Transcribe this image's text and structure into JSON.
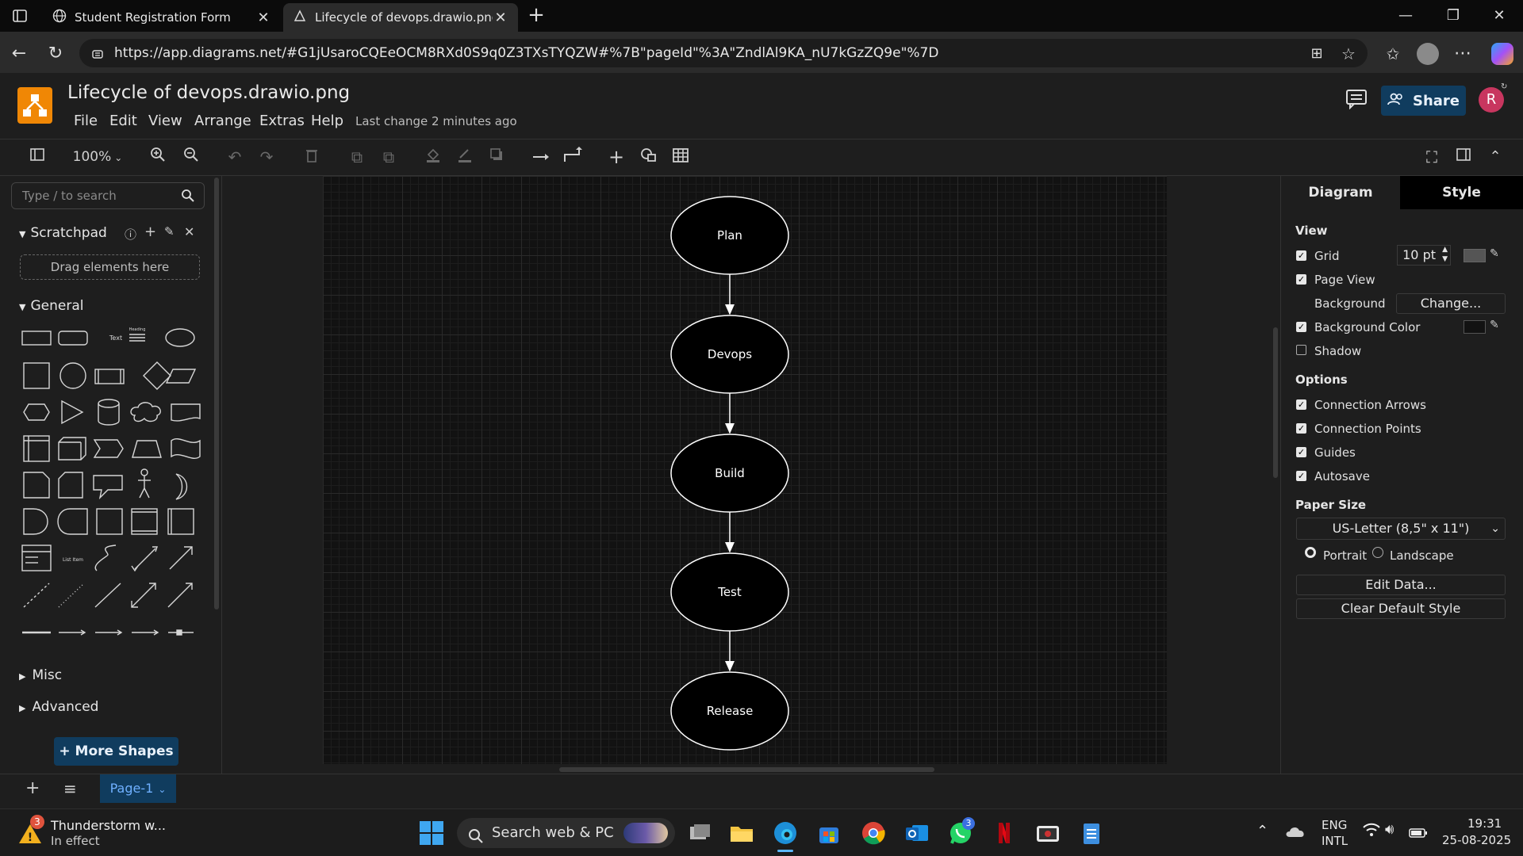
{
  "browser": {
    "tabs": [
      {
        "label": "Student Registration Form",
        "close": "✕"
      },
      {
        "label": "Lifecycle of devops.drawio.png - (",
        "close": "✕"
      }
    ],
    "new_tab": "+",
    "url": "https://app.diagrams.net/#G1jUsaroCQEeOCM8RXd0S9q0Z3TXsTYQZW#%7B\"pageId\"%3A\"ZndlAl9KA_nU7kGzZQ9e\"%7D"
  },
  "app": {
    "title": "Lifecycle of devops.drawio.png",
    "menu": [
      "File",
      "Edit",
      "View",
      "Arrange",
      "Extras",
      "Help"
    ],
    "last_change": "Last change 2 minutes ago",
    "share": "Share",
    "avatar": "R",
    "zoom": "100%"
  },
  "sidebar": {
    "search_placeholder": "Type / to search",
    "scratchpad": "Scratchpad",
    "drag_hint": "Drag elements here",
    "general": "General",
    "misc": "Misc",
    "advanced": "Advanced",
    "more_shapes": "+ More Shapes",
    "shape_text_label": "Text",
    "shape_heading_label": "Heading",
    "shape_list_label": "List Item"
  },
  "diagram": {
    "nodes": [
      "Plan",
      "Devops",
      "Build",
      "Test",
      "Release"
    ]
  },
  "format_panel": {
    "tabs": [
      "Diagram",
      "Style"
    ],
    "view_heading": "View",
    "grid": {
      "label": "Grid",
      "checked": true,
      "size": "10 pt"
    },
    "page_view": {
      "label": "Page View",
      "checked": true
    },
    "background": {
      "label": "Background",
      "button": "Change..."
    },
    "background_color": {
      "label": "Background Color",
      "checked": true
    },
    "shadow": {
      "label": "Shadow",
      "checked": false
    },
    "options_heading": "Options",
    "options": [
      {
        "label": "Connection Arrows",
        "checked": true
      },
      {
        "label": "Connection Points",
        "checked": true
      },
      {
        "label": "Guides",
        "checked": true
      },
      {
        "label": "Autosave",
        "checked": true
      }
    ],
    "paper_size_heading": "Paper Size",
    "paper_size": "US-Letter (8,5\" x 11\")",
    "orientation": {
      "portrait": "Portrait",
      "landscape": "Landscape",
      "selected": "Portrait"
    },
    "edit_data": "Edit Data...",
    "clear_default_style": "Clear Default Style"
  },
  "pages": {
    "current": "Page-1"
  },
  "taskbar": {
    "weather_title": "Thunderstorm w...",
    "weather_status": "In effect",
    "weather_badge": "3",
    "search": "Search web & PC",
    "whatsapp_badge": "3",
    "lang_1": "ENG",
    "lang_2": "INTL",
    "time": "19:31",
    "date": "25-08-2025"
  },
  "colors": {
    "accent": "#103c5e",
    "drawio_orange": "#f08705",
    "canvas": "#121212",
    "avatar": "#c8365f"
  }
}
